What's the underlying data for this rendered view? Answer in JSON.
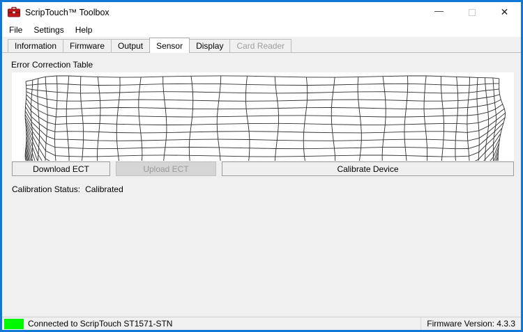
{
  "window": {
    "title": "ScripTouch™ Toolbox",
    "controls": {
      "minimize_glyph": "—",
      "close_glyph": "✕"
    }
  },
  "menu": {
    "items": [
      {
        "label": "File"
      },
      {
        "label": "Settings"
      },
      {
        "label": "Help"
      }
    ]
  },
  "tabs": [
    {
      "label": "Information",
      "active": false,
      "disabled": false
    },
    {
      "label": "Firmware",
      "active": false,
      "disabled": false
    },
    {
      "label": "Output",
      "active": false,
      "disabled": false
    },
    {
      "label": "Sensor",
      "active": true,
      "disabled": false
    },
    {
      "label": "Display",
      "active": false,
      "disabled": false
    },
    {
      "label": "Card Reader",
      "active": false,
      "disabled": true
    }
  ],
  "sensor_tab": {
    "section_title": "Error Correction Table",
    "buttons": [
      {
        "label": "Download ECT",
        "enabled": true
      },
      {
        "label": "Upload ECT",
        "enabled": false
      },
      {
        "label": "Calibrate Device",
        "enabled": true
      }
    ],
    "calibration_status_label": "Calibration Status:",
    "calibration_status_value": "Calibrated",
    "mesh": {
      "rows": 22,
      "cols": 28,
      "line_color": "#2f2f2f"
    }
  },
  "status_bar": {
    "indicator_color": "#00f800",
    "connection_text": "Connected to ScripTouch ST1571-STN",
    "firmware_text": "Firmware Version: 4.3.3"
  },
  "colors": {
    "window_border": "#0f78d7",
    "pane_background": "#f0f0f0",
    "app_icon_red": "#c0161c"
  }
}
